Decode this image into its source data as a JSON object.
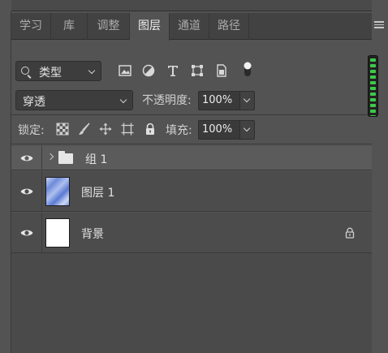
{
  "tabs": [
    {
      "label": "学习",
      "active": false
    },
    {
      "label": "库",
      "active": false
    },
    {
      "label": "调整",
      "active": false
    },
    {
      "label": "图层",
      "active": true
    },
    {
      "label": "通道",
      "active": false
    },
    {
      "label": "路径",
      "active": false
    }
  ],
  "filter": {
    "kind_label": "类型",
    "icons": [
      "pixel-layer-filter-icon",
      "adjustment-layer-filter-icon",
      "type-layer-filter-icon",
      "shape-layer-filter-icon",
      "smart-object-filter-icon",
      "filter-toggle-icon"
    ]
  },
  "blend": {
    "mode": "穿透",
    "opacity_label": "不透明度:",
    "opacity_value": "100%"
  },
  "lock": {
    "label": "锁定:",
    "fill_label": "填充:",
    "fill_value": "100%"
  },
  "layers": [
    {
      "type": "group",
      "name": "组 1",
      "visible": true,
      "collapsed": true
    },
    {
      "type": "pixel",
      "name": "图层 1",
      "visible": true
    },
    {
      "type": "background",
      "name": "背景",
      "visible": true,
      "locked": true
    }
  ],
  "colors": {
    "panel_bg": "#535353",
    "tab_bar": "#424242",
    "group_row": "#5b5b5b",
    "layer_row": "#4c4c4c",
    "accent_green": "#3dc94a"
  }
}
